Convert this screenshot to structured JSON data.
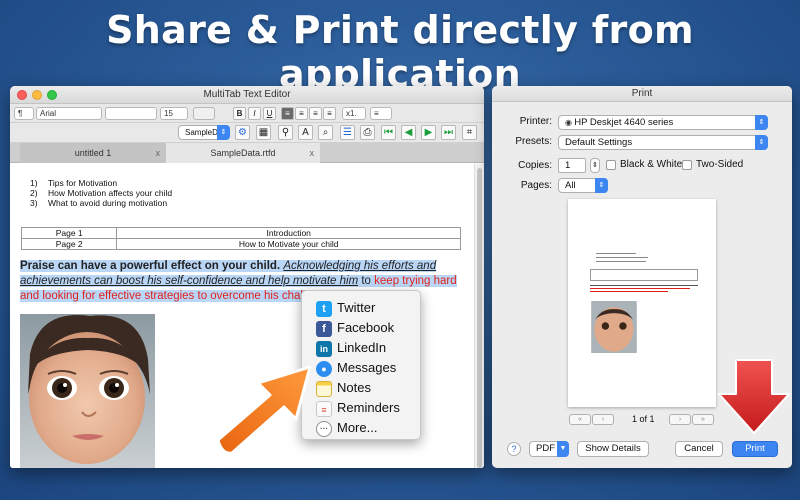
{
  "headline": "Share & Print directly from application",
  "editor": {
    "window_title": "MultiTab Text Editor",
    "toolbar": {
      "paragraph_style": "¶",
      "font": "Arial",
      "font_size": "15",
      "bold": "B",
      "italic": "I",
      "underline": "U",
      "line_spacing": "x1.",
      "list": "≡"
    },
    "toolbar2": {
      "document_menu": "SampleD..."
    },
    "tabs": [
      {
        "label": "untitled 1",
        "close": "x"
      },
      {
        "label": "SampleData.rtfd",
        "close": "x"
      }
    ],
    "document": {
      "list": [
        {
          "num": "1)",
          "text": "Tips for Motivation"
        },
        {
          "num": "2)",
          "text": "How Motivation affects your child"
        },
        {
          "num": "3)",
          "text": "What to avoid during motivation"
        }
      ],
      "table": [
        [
          "Page 1",
          "Introduction"
        ],
        [
          "Page 2",
          "How to Motivate your child"
        ]
      ],
      "para_bold": "Praise can have a powerful effect on your child. ",
      "para_italic": "Acknowledging his efforts and achievements can boost his self-confidence and help motivate him",
      "para_plain": " to ",
      "para_red": "keep trying hard and looking for effective strategies to overcome his challenges",
      "para_end": "."
    }
  },
  "share_menu": {
    "items": [
      {
        "label": "Twitter",
        "icon": "twitter-icon",
        "color": "#1da1f2",
        "glyph": "t"
      },
      {
        "label": "Facebook",
        "icon": "facebook-icon",
        "color": "#3b5998",
        "glyph": "f"
      },
      {
        "label": "LinkedIn",
        "icon": "linkedin-icon",
        "color": "#0e76a8",
        "glyph": "in"
      },
      {
        "label": "Messages",
        "icon": "messages-icon",
        "color": "#2d8cf0",
        "glyph": "💬"
      },
      {
        "label": "Notes",
        "icon": "notes-icon",
        "color": "#f5c542",
        "glyph": ""
      },
      {
        "label": "Reminders",
        "icon": "reminders-icon",
        "color": "#e9e9e9",
        "glyph": ""
      },
      {
        "label": "More...",
        "icon": "more-icon",
        "color": "#ffffff",
        "glyph": "···"
      }
    ]
  },
  "print": {
    "window_title": "Print",
    "printer_label": "Printer:",
    "printer_value": "HP Deskjet 4640 series",
    "presets_label": "Presets:",
    "presets_value": "Default Settings",
    "copies_label": "Copies:",
    "copies_value": "1",
    "bw_label": "Black & White",
    "two_sided_label": "Two-Sided",
    "pages_label": "Pages:",
    "pages_value": "All",
    "page_indicator": "1 of 1",
    "help_label": "?",
    "pdf_label": "PDF",
    "show_details_label": "Show Details",
    "cancel_label": "Cancel",
    "print_label": "Print"
  },
  "colors": {
    "accent": "#3d86f2",
    "highlight": "#b9d6f7",
    "red_text": "#e0211a",
    "orange_arrow": "#f07a1a",
    "red_arrow": "#e2262b"
  }
}
